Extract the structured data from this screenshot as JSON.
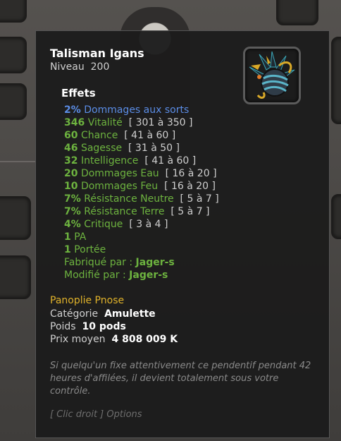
{
  "item": {
    "name": "Talisman Igans",
    "level_label": "Niveau",
    "level_value": "200",
    "icon": "amulet-icon"
  },
  "effects_title": "Effets",
  "effects": [
    {
      "value": "2%",
      "name": "Dommages aux sorts",
      "range": "",
      "color": "blue"
    },
    {
      "value": "346",
      "name": "Vitalité",
      "range": "[ 301 à 350 ]",
      "color": "green"
    },
    {
      "value": "60",
      "name": "Chance",
      "range": "[ 41 à 60 ]",
      "color": "green"
    },
    {
      "value": "46",
      "name": "Sagesse",
      "range": "[ 31 à 50 ]",
      "color": "green"
    },
    {
      "value": "32",
      "name": "Intelligence",
      "range": "[ 41 à 60 ]",
      "color": "green"
    },
    {
      "value": "20",
      "name": "Dommages Eau",
      "range": "[ 16 à 20 ]",
      "color": "green"
    },
    {
      "value": "10",
      "name": "Dommages Feu",
      "range": "[ 16 à 20 ]",
      "color": "green"
    },
    {
      "value": "7%",
      "name": "Résistance Neutre",
      "range": "[ 5 à 7 ]",
      "color": "green"
    },
    {
      "value": "7%",
      "name": "Résistance Terre",
      "range": "[ 5 à 7 ]",
      "color": "green"
    },
    {
      "value": "4%",
      "name": "Critique",
      "range": "[ 3 à 4 ]",
      "color": "green"
    },
    {
      "value": "1",
      "name": "PA",
      "range": "",
      "color": "green"
    },
    {
      "value": "1",
      "name": "Portée",
      "range": "",
      "color": "green"
    }
  ],
  "crafted_label": "Fabriqué par :",
  "crafted_by": "Jager-s",
  "modified_label": "Modifié par :",
  "modified_by": "Jager-s",
  "set_name": "Panoplie Pnose",
  "category_label": "Catégorie",
  "category_value": "Amulette",
  "weight_label": "Poids",
  "weight_value": "10 pods",
  "price_label": "Prix moyen",
  "price_value": "4 808 009 K",
  "description": "Si quelqu'un fixe attentivement ce pendentif pendant 42 heures d'affilées, il devient totalement sous votre contrôle.",
  "hint": "[ Clic droit ] Options",
  "colors": {
    "effect_green": "#6db33f",
    "effect_blue": "#5b8de6",
    "set_gold": "#e0b22a"
  }
}
